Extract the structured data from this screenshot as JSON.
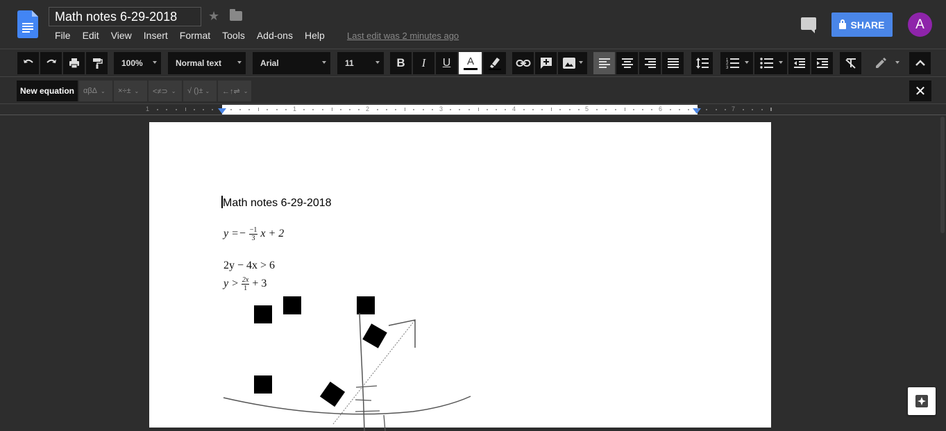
{
  "document": {
    "title": "Math notes 6-29-2018",
    "last_edit": "Last edit was 2 minutes ago"
  },
  "menu": [
    "File",
    "Edit",
    "View",
    "Insert",
    "Format",
    "Tools",
    "Add-ons",
    "Help"
  ],
  "header": {
    "share_label": "SHARE",
    "avatar_letter": "A",
    "accent_color": "#4a86e8",
    "avatar_color": "#8e24aa"
  },
  "toolbar": {
    "zoom": "100%",
    "style": "Normal text",
    "font": "Arial",
    "font_size": "11",
    "icons": [
      "undo-icon",
      "redo-icon",
      "print-icon",
      "paint-format-icon",
      "bold-icon",
      "italic-icon",
      "underline-icon",
      "text-color-icon",
      "highlight-icon",
      "link-icon",
      "add-comment-icon",
      "image-icon",
      "align-left-icon",
      "align-center-icon",
      "align-right-icon",
      "justify-icon",
      "line-spacing-icon",
      "numbered-list-icon",
      "bulleted-list-icon",
      "decrease-indent-icon",
      "increase-indent-icon",
      "clear-format-icon",
      "edit-mode-icon",
      "collapse-icon"
    ]
  },
  "equation_bar": {
    "new_label": "New equation",
    "groups": [
      "αβΔ",
      "×÷±",
      "<≠⊃",
      "√ ()±",
      "←↑⇌"
    ],
    "close_label": "✕"
  },
  "ruler": {
    "labels": [
      "1",
      "1",
      "2",
      "3",
      "4",
      "5",
      "6",
      "7"
    ]
  },
  "content": {
    "heading": "Math notes 6-29-2018",
    "eq1": {
      "lhs": "y =−",
      "num": "−1",
      "den": "3",
      "rhs": "x + 2"
    },
    "eq2": "2y − 4x > 6",
    "eq3": {
      "lhs": "y >",
      "num": "2x",
      "den": "1",
      "rhs": "+ 3"
    }
  }
}
